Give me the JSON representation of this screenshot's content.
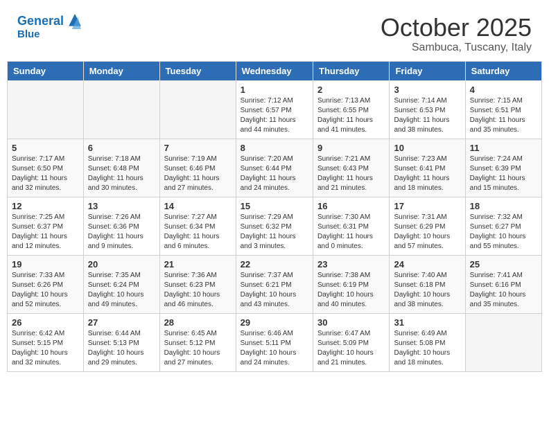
{
  "header": {
    "logo_line1": "General",
    "logo_line2": "Blue",
    "month": "October 2025",
    "location": "Sambuca, Tuscany, Italy"
  },
  "days_of_week": [
    "Sunday",
    "Monday",
    "Tuesday",
    "Wednesday",
    "Thursday",
    "Friday",
    "Saturday"
  ],
  "weeks": [
    [
      {
        "day": "",
        "empty": true
      },
      {
        "day": "",
        "empty": true
      },
      {
        "day": "",
        "empty": true
      },
      {
        "day": "1",
        "sunrise": "7:12 AM",
        "sunset": "6:57 PM",
        "daylight": "11 hours and 44 minutes."
      },
      {
        "day": "2",
        "sunrise": "7:13 AM",
        "sunset": "6:55 PM",
        "daylight": "11 hours and 41 minutes."
      },
      {
        "day": "3",
        "sunrise": "7:14 AM",
        "sunset": "6:53 PM",
        "daylight": "11 hours and 38 minutes."
      },
      {
        "day": "4",
        "sunrise": "7:15 AM",
        "sunset": "6:51 PM",
        "daylight": "11 hours and 35 minutes."
      }
    ],
    [
      {
        "day": "5",
        "sunrise": "7:17 AM",
        "sunset": "6:50 PM",
        "daylight": "11 hours and 32 minutes."
      },
      {
        "day": "6",
        "sunrise": "7:18 AM",
        "sunset": "6:48 PM",
        "daylight": "11 hours and 30 minutes."
      },
      {
        "day": "7",
        "sunrise": "7:19 AM",
        "sunset": "6:46 PM",
        "daylight": "11 hours and 27 minutes."
      },
      {
        "day": "8",
        "sunrise": "7:20 AM",
        "sunset": "6:44 PM",
        "daylight": "11 hours and 24 minutes."
      },
      {
        "day": "9",
        "sunrise": "7:21 AM",
        "sunset": "6:43 PM",
        "daylight": "11 hours and 21 minutes."
      },
      {
        "day": "10",
        "sunrise": "7:23 AM",
        "sunset": "6:41 PM",
        "daylight": "11 hours and 18 minutes."
      },
      {
        "day": "11",
        "sunrise": "7:24 AM",
        "sunset": "6:39 PM",
        "daylight": "11 hours and 15 minutes."
      }
    ],
    [
      {
        "day": "12",
        "sunrise": "7:25 AM",
        "sunset": "6:37 PM",
        "daylight": "11 hours and 12 minutes."
      },
      {
        "day": "13",
        "sunrise": "7:26 AM",
        "sunset": "6:36 PM",
        "daylight": "11 hours and 9 minutes."
      },
      {
        "day": "14",
        "sunrise": "7:27 AM",
        "sunset": "6:34 PM",
        "daylight": "11 hours and 6 minutes."
      },
      {
        "day": "15",
        "sunrise": "7:29 AM",
        "sunset": "6:32 PM",
        "daylight": "11 hours and 3 minutes."
      },
      {
        "day": "16",
        "sunrise": "7:30 AM",
        "sunset": "6:31 PM",
        "daylight": "11 hours and 0 minutes."
      },
      {
        "day": "17",
        "sunrise": "7:31 AM",
        "sunset": "6:29 PM",
        "daylight": "10 hours and 57 minutes."
      },
      {
        "day": "18",
        "sunrise": "7:32 AM",
        "sunset": "6:27 PM",
        "daylight": "10 hours and 55 minutes."
      }
    ],
    [
      {
        "day": "19",
        "sunrise": "7:33 AM",
        "sunset": "6:26 PM",
        "daylight": "10 hours and 52 minutes."
      },
      {
        "day": "20",
        "sunrise": "7:35 AM",
        "sunset": "6:24 PM",
        "daylight": "10 hours and 49 minutes."
      },
      {
        "day": "21",
        "sunrise": "7:36 AM",
        "sunset": "6:23 PM",
        "daylight": "10 hours and 46 minutes."
      },
      {
        "day": "22",
        "sunrise": "7:37 AM",
        "sunset": "6:21 PM",
        "daylight": "10 hours and 43 minutes."
      },
      {
        "day": "23",
        "sunrise": "7:38 AM",
        "sunset": "6:19 PM",
        "daylight": "10 hours and 40 minutes."
      },
      {
        "day": "24",
        "sunrise": "7:40 AM",
        "sunset": "6:18 PM",
        "daylight": "10 hours and 38 minutes."
      },
      {
        "day": "25",
        "sunrise": "7:41 AM",
        "sunset": "6:16 PM",
        "daylight": "10 hours and 35 minutes."
      }
    ],
    [
      {
        "day": "26",
        "sunrise": "6:42 AM",
        "sunset": "5:15 PM",
        "daylight": "10 hours and 32 minutes."
      },
      {
        "day": "27",
        "sunrise": "6:44 AM",
        "sunset": "5:13 PM",
        "daylight": "10 hours and 29 minutes."
      },
      {
        "day": "28",
        "sunrise": "6:45 AM",
        "sunset": "5:12 PM",
        "daylight": "10 hours and 27 minutes."
      },
      {
        "day": "29",
        "sunrise": "6:46 AM",
        "sunset": "5:11 PM",
        "daylight": "10 hours and 24 minutes."
      },
      {
        "day": "30",
        "sunrise": "6:47 AM",
        "sunset": "5:09 PM",
        "daylight": "10 hours and 21 minutes."
      },
      {
        "day": "31",
        "sunrise": "6:49 AM",
        "sunset": "5:08 PM",
        "daylight": "10 hours and 18 minutes."
      },
      {
        "day": "",
        "empty": true
      }
    ]
  ]
}
